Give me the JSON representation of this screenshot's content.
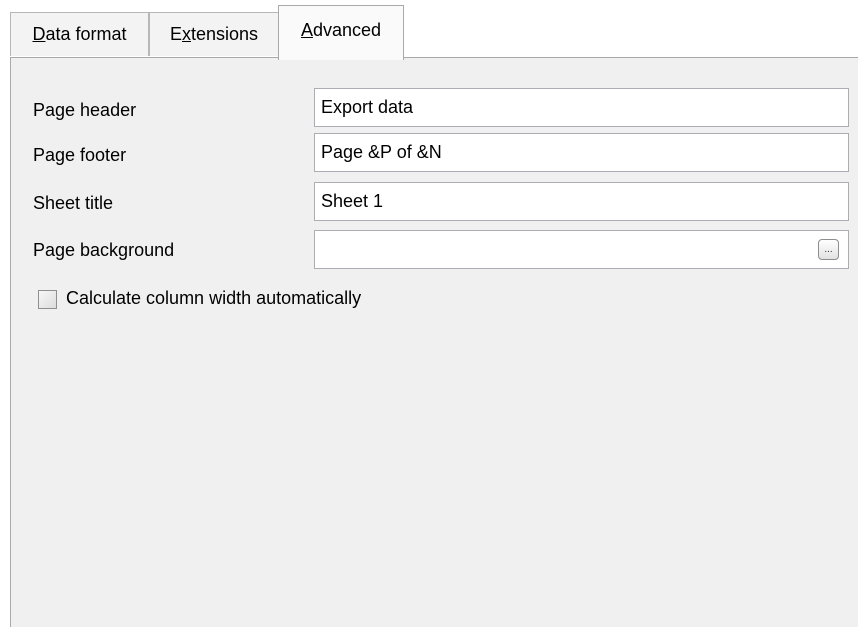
{
  "tabs": {
    "data_format": {
      "prefix": "",
      "accel": "D",
      "rest": "ata format"
    },
    "extensions": {
      "prefix": "E",
      "accel": "x",
      "rest": "tensions"
    },
    "advanced": {
      "prefix": "",
      "accel": "A",
      "rest": "dvanced"
    }
  },
  "form": {
    "page_header": {
      "label": "Page header",
      "value": "Export data"
    },
    "page_footer": {
      "label": "Page footer",
      "value": "Page &P of &N"
    },
    "sheet_title": {
      "label": "Sheet title",
      "value": "Sheet 1"
    },
    "page_background": {
      "label": "Page background",
      "value": "",
      "browse_label": "..."
    }
  },
  "options": {
    "auto_column_width": {
      "label": "Calculate column width automatically",
      "checked": false
    }
  }
}
